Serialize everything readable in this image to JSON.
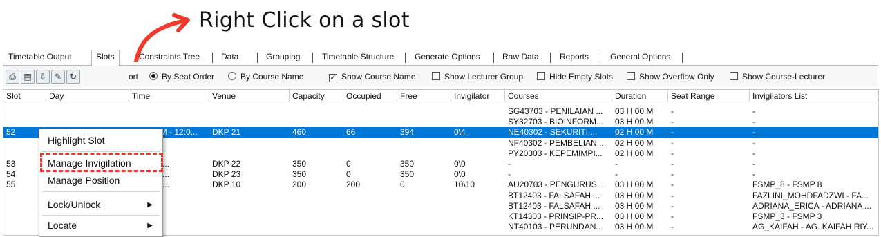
{
  "annotation": {
    "text": "Right Click on a slot",
    "arrow_color": "#f03a2e",
    "highlight_color": "#e53935"
  },
  "tabs": [
    {
      "label": "Timetable Output"
    },
    {
      "label": "Slots",
      "active": true
    },
    {
      "label": "Constraints Tree"
    },
    {
      "label": "Data"
    },
    {
      "label": "Grouping"
    },
    {
      "label": "Timetable Structure"
    },
    {
      "label": "Generate Options"
    },
    {
      "label": "Raw Data"
    },
    {
      "label": "Reports"
    },
    {
      "label": "General Options"
    }
  ],
  "toolbar": {
    "icons": [
      "print-icon",
      "print-preview-icon",
      "export-icon",
      "edit-icon",
      "refresh-icon"
    ],
    "sort_partial": "ort",
    "sort_by_seat": "By Seat Order",
    "sort_by_course": "By Course Name",
    "show_course_name": "Show Course Name",
    "show_lecturer_group": "Show Lecturer Group",
    "hide_empty_slots": "Hide Empty Slots",
    "show_overflow_only": "Show Overflow Only",
    "show_course_lecturer": "Show Course-Lecturer"
  },
  "table": {
    "columns": [
      "Slot",
      "Day",
      "Time",
      "Venue",
      "Capacity",
      "Occupied",
      "Free",
      "Invigilator",
      "Courses",
      "Duration",
      "Seat Range",
      "Invigilators List"
    ],
    "rows": [
      [
        "",
        "",
        "",
        "",
        "",
        "",
        "",
        "",
        "SG43703 - PENILAIAN ...",
        "03 H 00 M",
        "-",
        "-"
      ],
      [
        "",
        "",
        "",
        "",
        "",
        "",
        "",
        "",
        "SY32703 - BIOINFORM...",
        "03 H 00 M",
        "-",
        "-"
      ],
      [
        "52",
        "11-3-2026 (Wed)",
        "09:00 AM - 12:0...",
        "DKP 21",
        "460",
        "66",
        "394",
        "0\\4",
        "NE40302 - SEKURITI ...",
        "02 H 00 M",
        "-",
        "-"
      ],
      [
        "",
        "",
        "",
        "",
        "",
        "",
        "",
        "",
        "NF40302 - PEMBELIAN...",
        "02 H 00 M",
        "-",
        "-"
      ],
      [
        "",
        "",
        "",
        "",
        "",
        "",
        "",
        "",
        "PY20303 - KEPEMIMPI...",
        "02 H 00 M",
        "-",
        "-"
      ],
      [
        "53",
        "",
        "M - 12:0...",
        "DKP 22",
        "350",
        "0",
        "350",
        "0\\0",
        "-",
        "-",
        "-",
        "-"
      ],
      [
        "54",
        "",
        "M - 12:0...",
        "DKP 23",
        "350",
        "0",
        "350",
        "0\\0",
        "-",
        "-",
        "-",
        "-"
      ],
      [
        "55",
        "",
        "M - 05:0...",
        "DKP 10",
        "200",
        "200",
        "0",
        "10\\10",
        "AU20703 - PENGURUS...",
        "03 H 00 M",
        "-",
        "FSMP_8 - FSMP 8"
      ],
      [
        "",
        "",
        "",
        "",
        "",
        "",
        "",
        "",
        "BT12403 - FALSAFAH ...",
        "03 H 00 M",
        "-",
        "FAZLINI_MOHDFADZWI - FA..."
      ],
      [
        "",
        "",
        "",
        "",
        "",
        "",
        "",
        "",
        "BT12403 - FALSAFAH ...",
        "03 H 00 M",
        "-",
        "ADRIANA_ERICA - ADRIANA ..."
      ],
      [
        "",
        "",
        "",
        "",
        "",
        "",
        "",
        "",
        "KT14303 - PRINSIP-PR...",
        "03 H 00 M",
        "-",
        "FSMP_3 - FSMP 3"
      ],
      [
        "",
        "",
        "",
        "",
        "",
        "",
        "",
        "",
        "NT40103 - PERUNDAN...",
        "03 H 00 M",
        "-",
        "AG_KAIFAH - AG. KAIFAH RIY..."
      ]
    ],
    "selected_row": 2
  },
  "context_menu": {
    "items": [
      {
        "label": "Highlight Slot",
        "submenu": false
      },
      {
        "label": "Manage Invigilation",
        "submenu": false
      },
      {
        "label": "Manage Position",
        "submenu": false
      },
      {
        "label": "Lock/Unlock",
        "submenu": true
      },
      {
        "label": "Locate",
        "submenu": true
      }
    ]
  }
}
